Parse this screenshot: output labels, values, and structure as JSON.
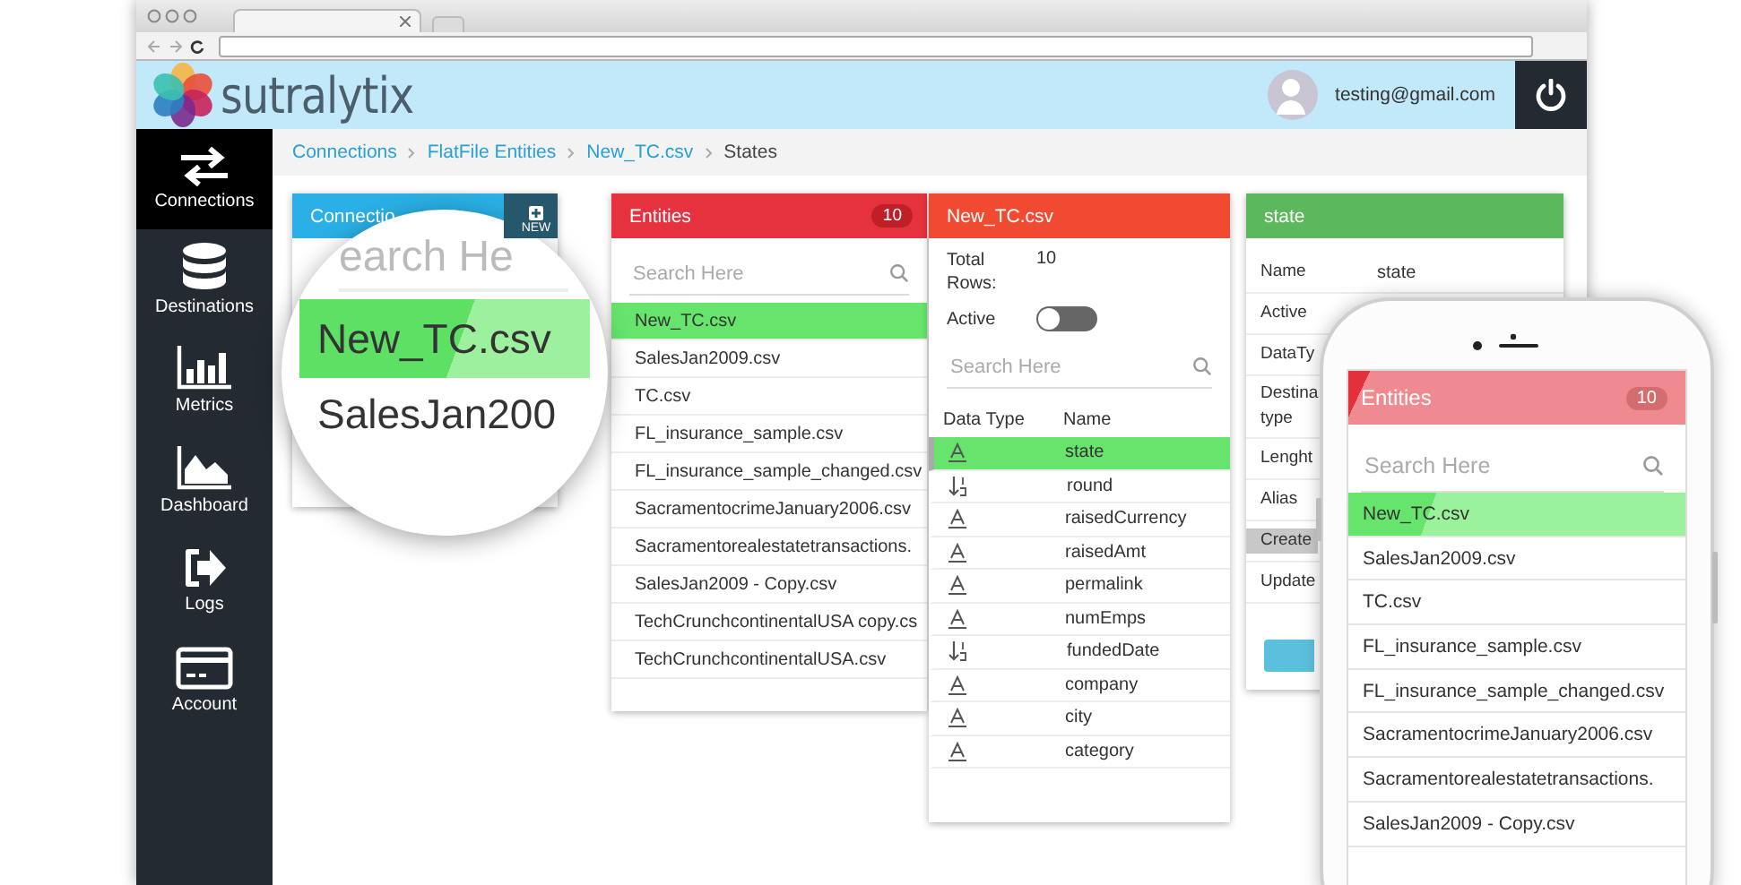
{
  "header": {
    "logo": "sutralytix",
    "user_email": "testing@gmail.com"
  },
  "sidebar": [
    {
      "label": "Connections",
      "selected": true
    },
    {
      "label": "Destinations",
      "selected": false
    },
    {
      "label": "Metrics",
      "selected": false
    },
    {
      "label": "Dashboard",
      "selected": false
    },
    {
      "label": "Logs",
      "selected": false
    },
    {
      "label": "Account",
      "selected": false
    }
  ],
  "breadcrumb": [
    {
      "label": "Connections",
      "current": false
    },
    {
      "label": "FlatFile Entities",
      "current": false
    },
    {
      "label": "New_TC.csv",
      "current": false
    },
    {
      "label": "States",
      "current": true
    }
  ],
  "connections_panel": {
    "title": "Connectio",
    "add_label": "NEW"
  },
  "magnifier": {
    "search_placeholder": "earch He",
    "items": [
      {
        "label": "New_TC.csv",
        "selected": true
      },
      {
        "label": "SalesJan200",
        "selected": false
      }
    ]
  },
  "entities_panel": {
    "title": "Entities",
    "count": "10",
    "search_placeholder": "Search Here",
    "items": [
      {
        "label": "New_TC.csv",
        "selected": true
      },
      {
        "label": "SalesJan2009.csv",
        "selected": false
      },
      {
        "label": "TC.csv",
        "selected": false
      },
      {
        "label": "FL_insurance_sample.csv",
        "selected": false
      },
      {
        "label": "FL_insurance_sample_changed.csv",
        "selected": false
      },
      {
        "label": "SacramentocrimeJanuary2006.csv",
        "selected": false
      },
      {
        "label": "Sacramentorealestatetransactions.",
        "selected": false
      },
      {
        "label": "SalesJan2009 - Copy.csv",
        "selected": false
      },
      {
        "label": "TechCrunchcontinentalUSA copy.cs",
        "selected": false
      },
      {
        "label": "TechCrunchcontinentalUSA.csv",
        "selected": false
      }
    ]
  },
  "file_panel": {
    "title": "New_TC.csv",
    "total_rows_label": "Total Rows:",
    "total_rows": "10",
    "active_label": "Active",
    "active": false,
    "search_placeholder": "Search Here",
    "columns": [
      "Data Type",
      "Name"
    ],
    "fields": [
      {
        "kind": "text",
        "name": "state",
        "selected": true
      },
      {
        "kind": "number",
        "name": "round",
        "selected": false
      },
      {
        "kind": "text",
        "name": "raisedCurrency",
        "selected": false
      },
      {
        "kind": "text",
        "name": "raisedAmt",
        "selected": false
      },
      {
        "kind": "text",
        "name": "permalink",
        "selected": false
      },
      {
        "kind": "text",
        "name": "numEmps",
        "selected": false
      },
      {
        "kind": "number",
        "name": "fundedDate",
        "selected": false
      },
      {
        "kind": "text",
        "name": "company",
        "selected": false
      },
      {
        "kind": "text",
        "name": "city",
        "selected": false
      },
      {
        "kind": "text",
        "name": "category",
        "selected": false
      }
    ]
  },
  "state_panel": {
    "title": "state",
    "rows": [
      {
        "label": "Name",
        "value": "state",
        "selected": false
      },
      {
        "label": "Active",
        "selected": false
      },
      {
        "label": "DataTy",
        "selected": false
      },
      {
        "label": "Destina type",
        "selected": false
      },
      {
        "label": "Lenght",
        "selected": false
      },
      {
        "label": "Alias",
        "selected": false
      },
      {
        "label": "Create",
        "selected": true
      },
      {
        "label": "Update",
        "selected": false
      }
    ]
  },
  "phone": {
    "title": "Entities",
    "count": "10",
    "search_placeholder": "Search Here",
    "items": [
      {
        "label": "New_TC.csv",
        "selected": true
      },
      {
        "label": "SalesJan2009.csv",
        "selected": false
      },
      {
        "label": "TC.csv",
        "selected": false
      },
      {
        "label": "FL_insurance_sample.csv",
        "selected": false
      },
      {
        "label": "FL_insurance_sample_changed.csv",
        "selected": false
      },
      {
        "label": "SacramentocrimeJanuary2006.csv",
        "selected": false
      },
      {
        "label": "Sacramentorealestatetransactions.",
        "selected": false
      },
      {
        "label": "SalesJan2009 - Copy.csv",
        "selected": false
      }
    ]
  }
}
